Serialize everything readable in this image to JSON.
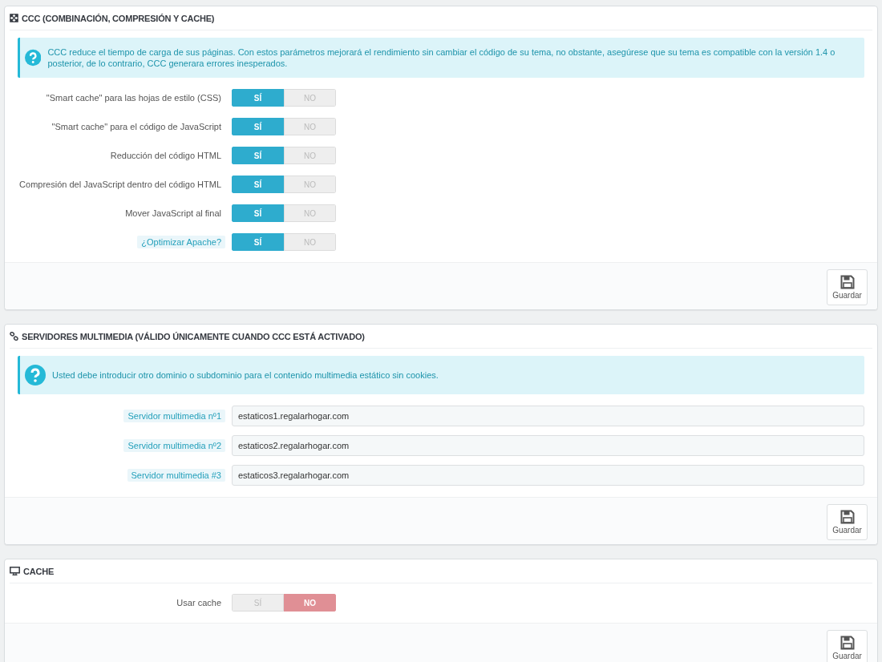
{
  "panels": [
    {
      "kind": "ccc",
      "title": "CCC (COMBINACIÓN, COMPRESIÓN Y CACHE)",
      "alert": "CCC reduce el tiempo de carga de sus páginas. Con estos parámetros mejorará el rendimiento sin cambiar el código de su tema, no obstante, asegúrese que su tema es compatible con la versión 1.4 o posterior, de lo contrario, CCC generara errores inesperados.",
      "fields": [
        {
          "kind": "toggle",
          "label": "\"Smart cache\" para las hojas de estilo (CSS)",
          "help": false,
          "options": [
            {
              "label": "SÍ",
              "selected": true
            },
            {
              "label": "NO",
              "selected": false
            }
          ]
        },
        {
          "kind": "toggle",
          "label": "\"Smart cache\" para el código de JavaScript",
          "help": false,
          "options": [
            {
              "label": "SÍ",
              "selected": true
            },
            {
              "label": "NO",
              "selected": false
            }
          ]
        },
        {
          "kind": "toggle",
          "label": "Reducción del código HTML",
          "help": false,
          "options": [
            {
              "label": "SÍ",
              "selected": true
            },
            {
              "label": "NO",
              "selected": false
            }
          ]
        },
        {
          "kind": "toggle",
          "label": "Compresión del JavaScript dentro del código HTML",
          "help": false,
          "options": [
            {
              "label": "SÍ",
              "selected": true
            },
            {
              "label": "NO",
              "selected": false
            }
          ]
        },
        {
          "kind": "toggle",
          "label": "Mover JavaScript al final",
          "help": false,
          "options": [
            {
              "label": "SÍ",
              "selected": true
            },
            {
              "label": "NO",
              "selected": false
            }
          ]
        },
        {
          "kind": "toggle",
          "label": "¿Optimizar Apache?",
          "help": true,
          "options": [
            {
              "label": "SÍ",
              "selected": true
            },
            {
              "label": "NO",
              "selected": false
            }
          ]
        }
      ],
      "save": "Guardar"
    },
    {
      "kind": "media",
      "title": "SERVIDORES MULTIMEDIA (VÁLIDO ÚNICAMENTE CUANDO CCC ESTÁ ACTIVADO)",
      "alert": "Usted debe introducir otro dominio o subdominio para el contenido multimedia estático sin cookies.",
      "fields": [
        {
          "kind": "text",
          "label": "Servidor multimedia nº1",
          "help": true,
          "value": "estaticos1.regalarhogar.com"
        },
        {
          "kind": "text",
          "label": "Servidor multimedia nº2",
          "help": true,
          "value": "estaticos2.regalarhogar.com"
        },
        {
          "kind": "text",
          "label": "Servidor multimedia #3",
          "help": true,
          "value": "estaticos3.regalarhogar.com"
        }
      ],
      "save": "Guardar"
    },
    {
      "kind": "cache",
      "title": "CACHE",
      "fields": [
        {
          "kind": "toggle",
          "label": "Usar cache",
          "help": false,
          "options": [
            {
              "label": "SÍ",
              "selected": false
            },
            {
              "label": "NO",
              "selected": true
            }
          ]
        }
      ],
      "save": "Guardar"
    }
  ]
}
